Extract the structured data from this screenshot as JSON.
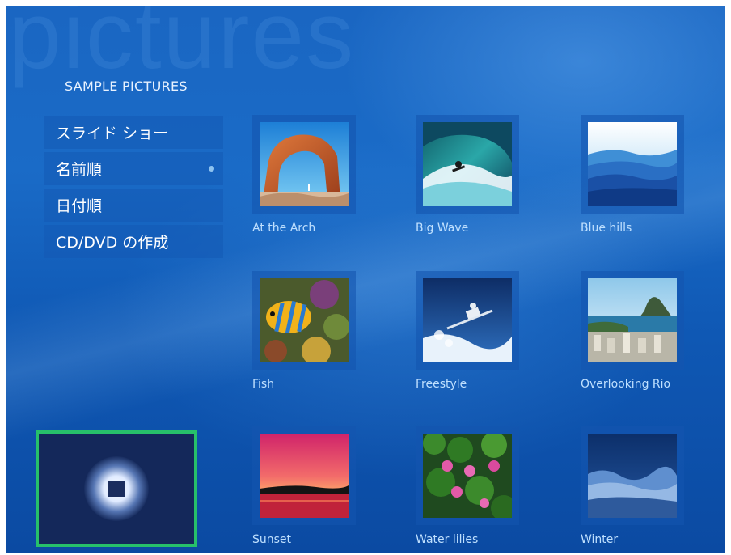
{
  "app": {
    "watermark": "pictures",
    "section_title": "SAMPLE PICTURES"
  },
  "menu": {
    "items": [
      {
        "label": "スライド ショー"
      },
      {
        "label": "名前順",
        "selected": true
      },
      {
        "label": "日付順"
      },
      {
        "label": "CD/DVD の作成"
      }
    ]
  },
  "gallery": {
    "items": [
      {
        "label": "At the Arch"
      },
      {
        "label": "Big Wave"
      },
      {
        "label": "Blue hills"
      },
      {
        "label": "Fish"
      },
      {
        "label": "Freestyle"
      },
      {
        "label": "Overlooking Rio"
      },
      {
        "label": "Sunset"
      },
      {
        "label": "Water lilies"
      },
      {
        "label": "Winter"
      }
    ]
  },
  "player": {
    "icon": "stop-icon",
    "border_color": "#27c06a"
  },
  "colors": {
    "background": "#1a66c2",
    "menu_dot": "#8ec3f0",
    "label_text": "#bfe0ff"
  }
}
